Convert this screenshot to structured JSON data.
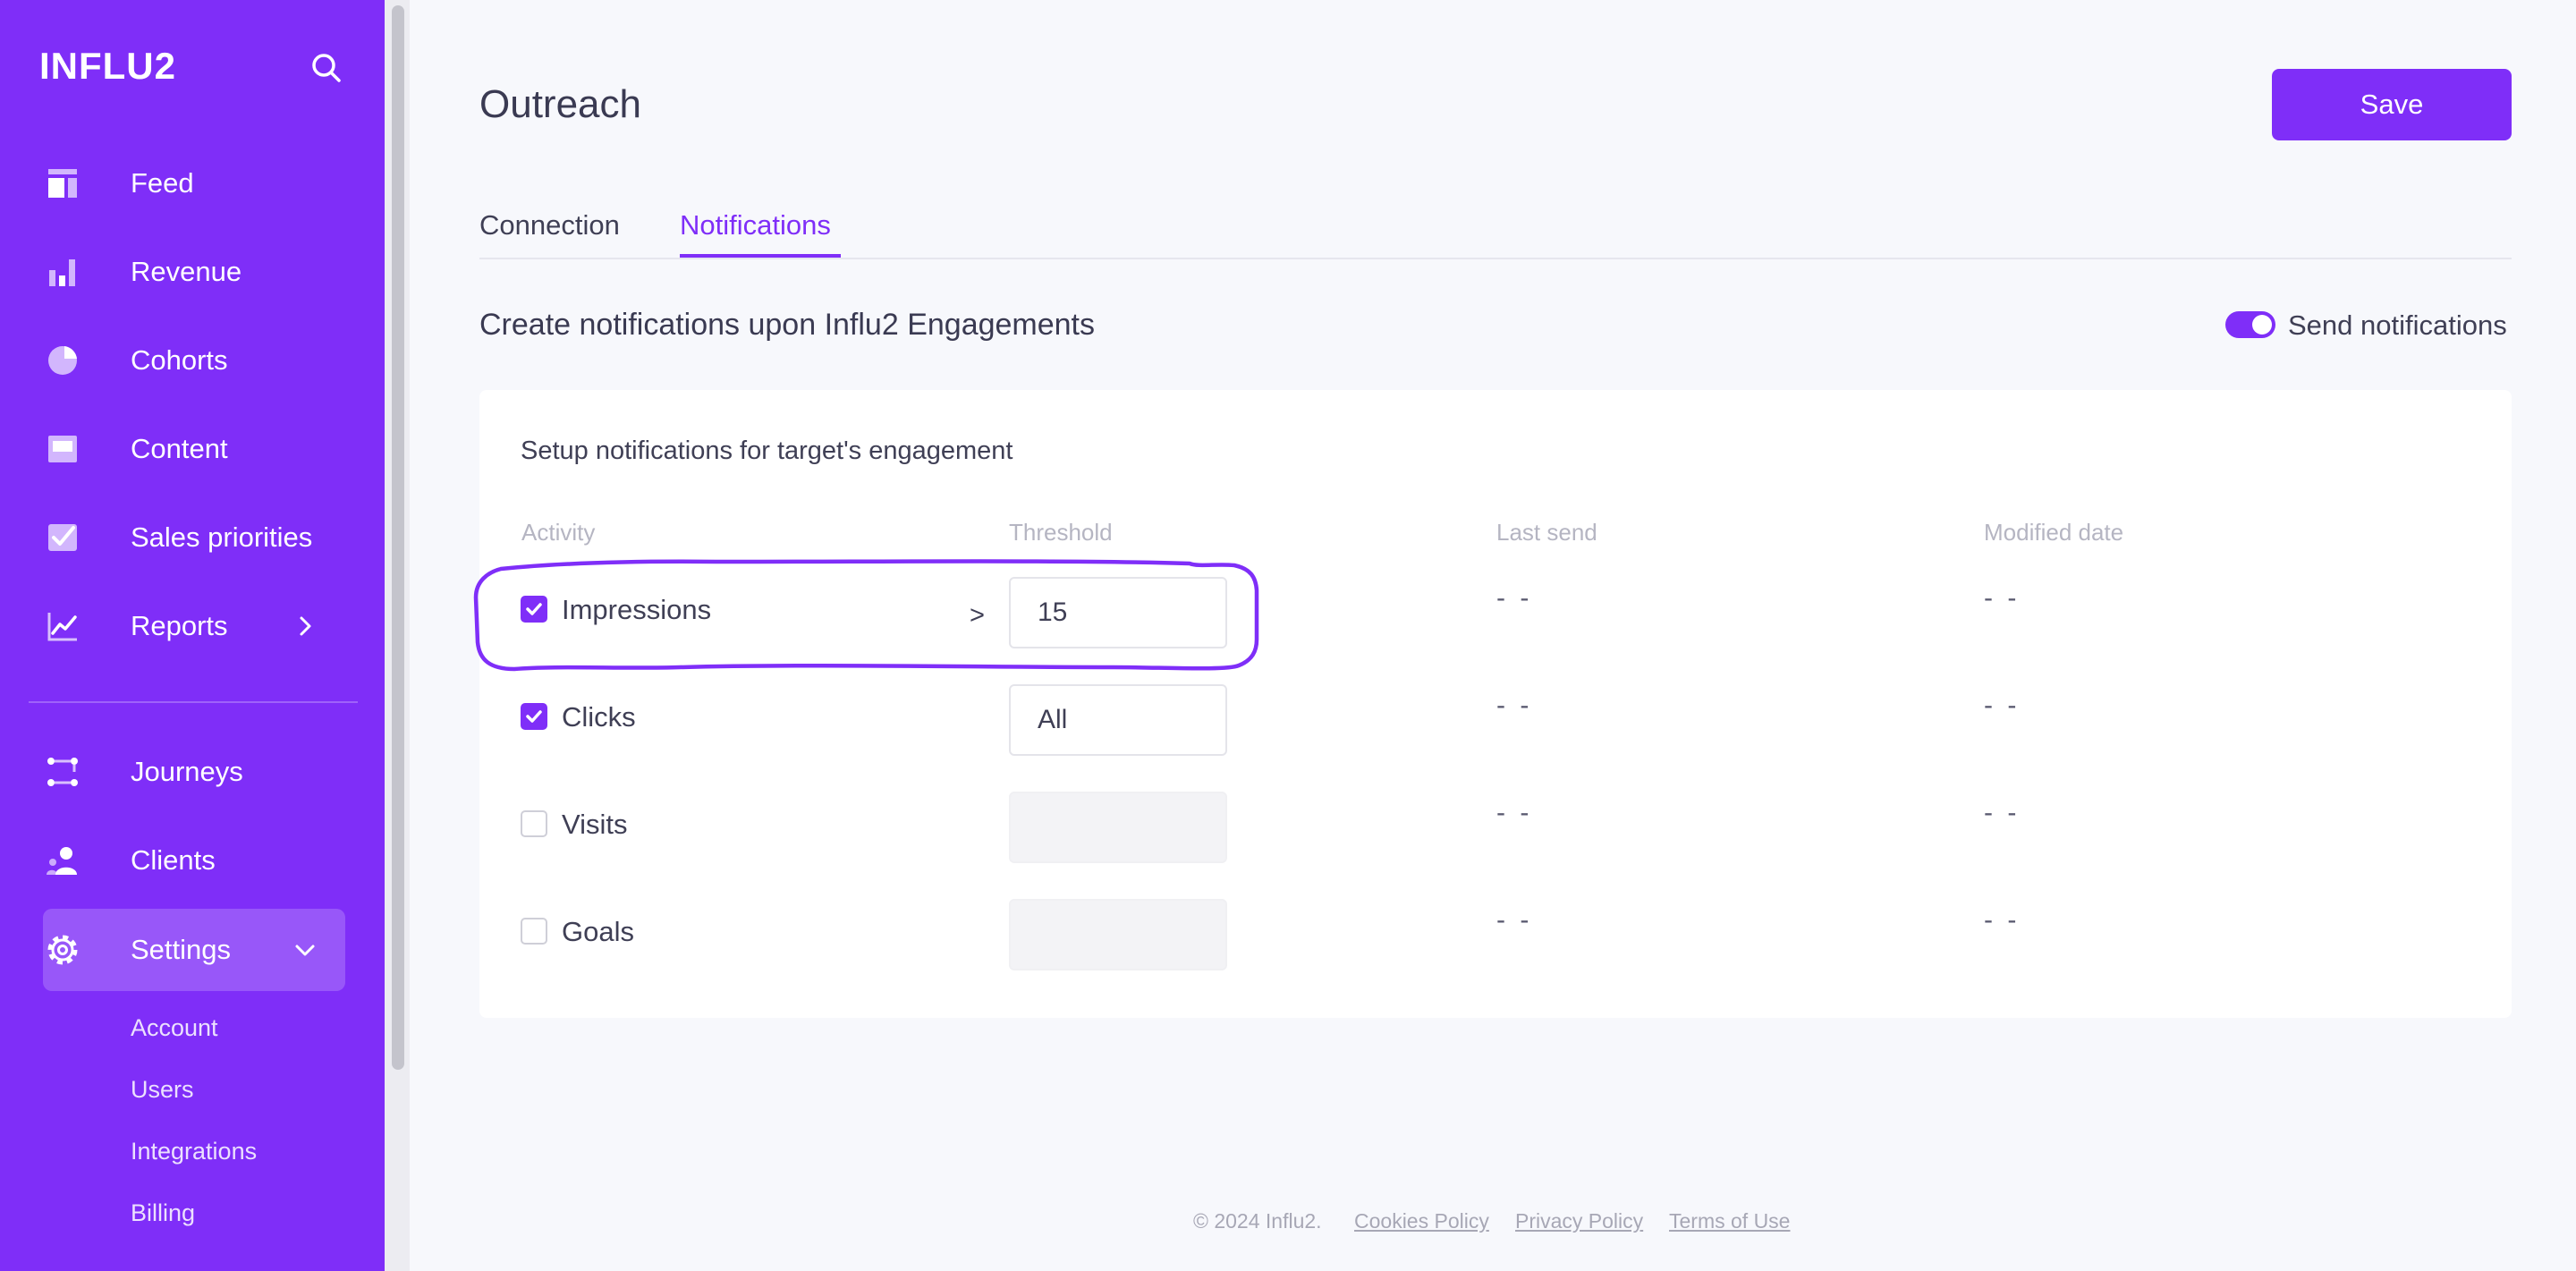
{
  "app": {
    "logo": "INFLU2"
  },
  "sidebar": {
    "items": [
      {
        "label": "Feed",
        "icon": "feed-icon"
      },
      {
        "label": "Revenue",
        "icon": "bar-chart-icon"
      },
      {
        "label": "Cohorts",
        "icon": "pie-chart-icon"
      },
      {
        "label": "Content",
        "icon": "content-icon"
      },
      {
        "label": "Sales priorities",
        "icon": "checkbox-icon"
      },
      {
        "label": "Reports",
        "icon": "line-chart-icon"
      },
      {
        "label": "Journeys",
        "icon": "journeys-icon"
      },
      {
        "label": "Clients",
        "icon": "users-icon"
      },
      {
        "label": "Settings",
        "icon": "gear-icon"
      }
    ],
    "sub_items": [
      "Account",
      "Users",
      "Integrations",
      "Billing"
    ]
  },
  "header": {
    "title": "Outreach",
    "save_label": "Save"
  },
  "tabs": [
    {
      "label": "Connection",
      "active": false
    },
    {
      "label": "Notifications",
      "active": true
    }
  ],
  "section": {
    "title": "Create notifications upon Influ2 Engagements",
    "toggle_label": "Send notifications",
    "toggle_on": true
  },
  "card": {
    "title": "Setup notifications for target's engagement",
    "columns": [
      "Activity",
      "Threshold",
      "Last send",
      "Modified date"
    ],
    "rows": [
      {
        "label": "Impressions",
        "checked": true,
        "operator": ">",
        "threshold": "15",
        "last_send": "- -",
        "modified": "- -"
      },
      {
        "label": "Clicks",
        "checked": true,
        "operator": "",
        "threshold": "All",
        "last_send": "- -",
        "modified": "- -"
      },
      {
        "label": "Visits",
        "checked": false,
        "operator": "",
        "threshold": "",
        "last_send": "- -",
        "modified": "- -"
      },
      {
        "label": "Goals",
        "checked": false,
        "operator": "",
        "threshold": "",
        "last_send": "- -",
        "modified": "- -"
      }
    ]
  },
  "footer": {
    "copyright": "© 2024 Influ2.",
    "links": [
      "Cookies Policy",
      "Privacy Policy",
      "Terms of Use"
    ]
  },
  "colors": {
    "brand": "#7f2ef8",
    "background": "#f7f8fc",
    "annotation": "#7f2ef8"
  }
}
